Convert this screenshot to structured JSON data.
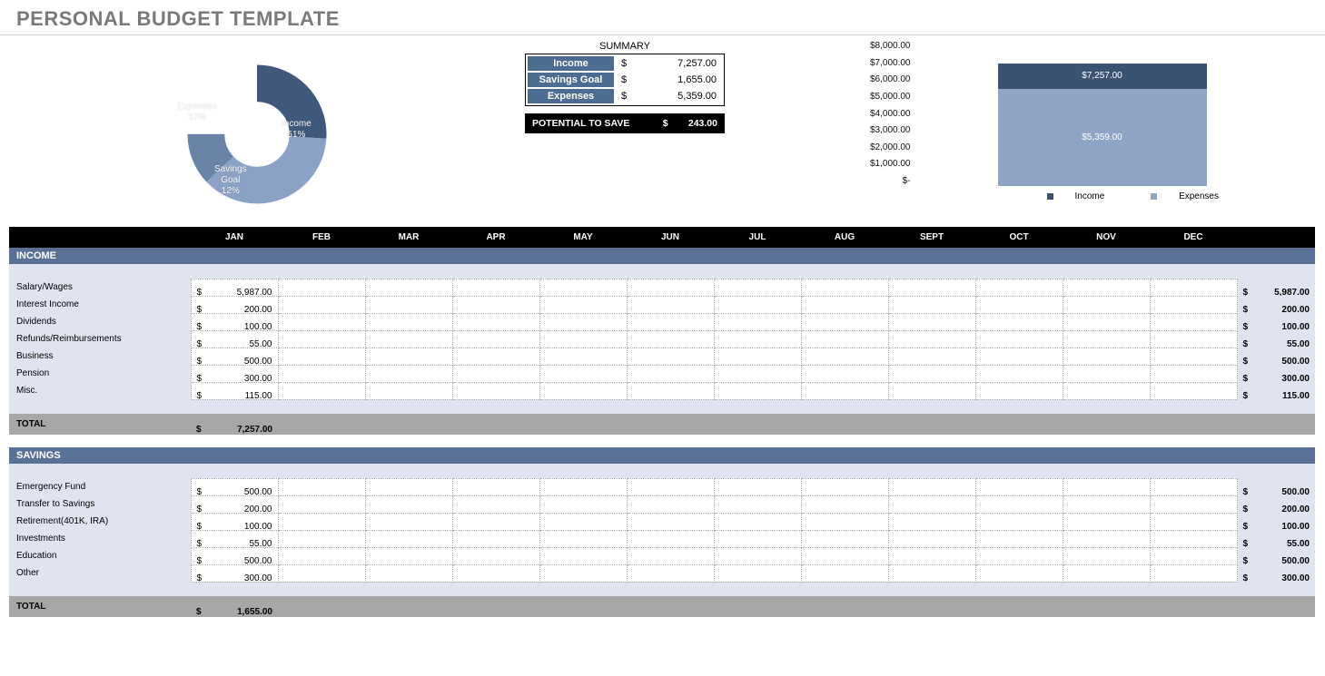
{
  "title": "PERSONAL BUDGET TEMPLATE",
  "months": [
    "JAN",
    "FEB",
    "MAR",
    "APR",
    "MAY",
    "JUN",
    "JUL",
    "AUG",
    "SEPT",
    "OCT",
    "NOV",
    "DEC"
  ],
  "summary": {
    "heading": "SUMMARY",
    "rows": {
      "income": {
        "label": "Income",
        "cur": "$",
        "value": "7,257.00"
      },
      "savings": {
        "label": "Savings Goal",
        "cur": "$",
        "value": "1,655.00"
      },
      "expenses": {
        "label": "Expenses",
        "cur": "$",
        "value": "5,359.00"
      }
    },
    "potential": {
      "label": "POTENTIAL TO SAVE",
      "cur": "$",
      "value": "243.00"
    }
  },
  "donut": {
    "labels": {
      "income": {
        "l1": "Income",
        "l2": "51%"
      },
      "expenses": {
        "l1": "Expenses",
        "l2": "37%"
      },
      "savings": {
        "l1": "Savings",
        "l2": "Goal",
        "l3": "12%"
      }
    }
  },
  "bar": {
    "axis": [
      "$8,000.00",
      "$7,000.00",
      "$6,000.00",
      "$5,000.00",
      "$4,000.00",
      "$3,000.00",
      "$2,000.00",
      "$1,000.00",
      "$-"
    ],
    "top_label": "$7,257.00",
    "bot_label": "$5,359.00",
    "legend": {
      "a": "Income",
      "b": "Expenses"
    }
  },
  "sections": {
    "income": {
      "title": "INCOME",
      "rows": [
        {
          "label": "Salary/Wages",
          "jan": "5,987.00",
          "total": "5,987.00"
        },
        {
          "label": "Interest Income",
          "jan": "200.00",
          "total": "200.00"
        },
        {
          "label": "Dividends",
          "jan": "100.00",
          "total": "100.00"
        },
        {
          "label": "Refunds/Reimbursements",
          "jan": "55.00",
          "total": "55.00"
        },
        {
          "label": "Business",
          "jan": "500.00",
          "total": "500.00"
        },
        {
          "label": "Pension",
          "jan": "300.00",
          "total": "300.00"
        },
        {
          "label": "Misc.",
          "jan": "115.00",
          "total": "115.00"
        }
      ],
      "total_label": "TOTAL",
      "total_value": "7,257.00"
    },
    "savings": {
      "title": "SAVINGS",
      "rows": [
        {
          "label": "Emergency Fund",
          "jan": "500.00",
          "total": "500.00"
        },
        {
          "label": "Transfer to Savings",
          "jan": "200.00",
          "total": "200.00"
        },
        {
          "label": "Retirement(401K, IRA)",
          "jan": "100.00",
          "total": "100.00"
        },
        {
          "label": "Investments",
          "jan": "55.00",
          "total": "55.00"
        },
        {
          "label": "Education",
          "jan": "500.00",
          "total": "500.00"
        },
        {
          "label": "Other",
          "jan": "300.00",
          "total": "300.00"
        }
      ],
      "total_label": "TOTAL",
      "total_value": "1,655.00"
    }
  },
  "chart_data": [
    {
      "type": "pie",
      "title": "",
      "series": [
        {
          "name": "Income",
          "value": 51,
          "color": "#3f587c"
        },
        {
          "name": "Expenses",
          "value": 37,
          "color": "#8ba1c5"
        },
        {
          "name": "Savings Goal",
          "value": 12,
          "color": "#6a84a8"
        }
      ]
    },
    {
      "type": "bar",
      "categories": [
        ""
      ],
      "series": [
        {
          "name": "Income",
          "values": [
            7257.0
          ],
          "color": "#3b5373"
        },
        {
          "name": "Expenses",
          "values": [
            5359.0
          ],
          "color": "#90a5c6"
        }
      ],
      "ylim": [
        0,
        8000
      ],
      "ylabel": "",
      "xlabel": ""
    }
  ]
}
